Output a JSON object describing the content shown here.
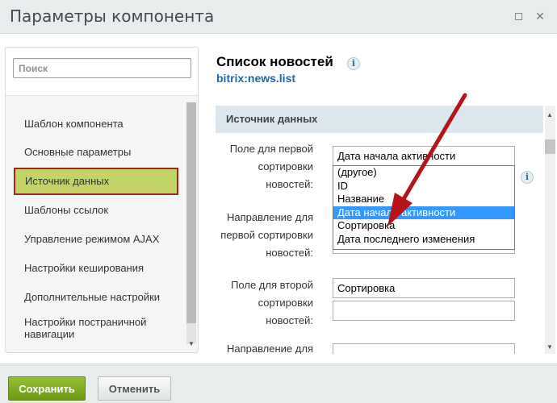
{
  "window": {
    "title": "Параметры компонента",
    "maximize_icon": "maximize-icon",
    "close_icon": "close-icon"
  },
  "sidebar": {
    "search_placeholder": "Поиск",
    "items": [
      {
        "label": "Шаблон компонента",
        "active": false
      },
      {
        "label": "Основные параметры",
        "active": false
      },
      {
        "label": "Источник данных",
        "active": true
      },
      {
        "label": "Шаблоны ссылок",
        "active": false
      },
      {
        "label": "Управление режимом AJAX",
        "active": false
      },
      {
        "label": "Настройки кеширования",
        "active": false
      },
      {
        "label": "Дополнительные настройки",
        "active": false
      },
      {
        "label": "Настройки постраничной навигации",
        "active": false
      }
    ]
  },
  "content": {
    "title": "Список новостей",
    "code": "bitrix:news.list",
    "section_title": "Источник данных",
    "fields": [
      {
        "label": "Поле для первой сортировки новостей:",
        "value": "Дата начала активности"
      },
      {
        "label": "Направление для первой сортировки новостей:",
        "value": ""
      },
      {
        "label": "Поле для второй сортировки новостей:",
        "value": "Сортировка"
      },
      {
        "label": "Направление для",
        "value": ""
      }
    ],
    "dropdown_options": [
      "(другое)",
      "ID",
      "Название",
      "Дата начала активности",
      "Сортировка",
      "Дата последнего изменения"
    ],
    "dropdown_selected": "Дата начала активности"
  },
  "footer": {
    "save_label": "Сохранить",
    "cancel_label": "Отменить"
  },
  "colors": {
    "save_button": "#7aa61b",
    "active_item_bg": "#c2d466",
    "active_item_border": "#a3261d",
    "annotation_arrow": "#b3151b",
    "selected_option": "#3399ff"
  }
}
